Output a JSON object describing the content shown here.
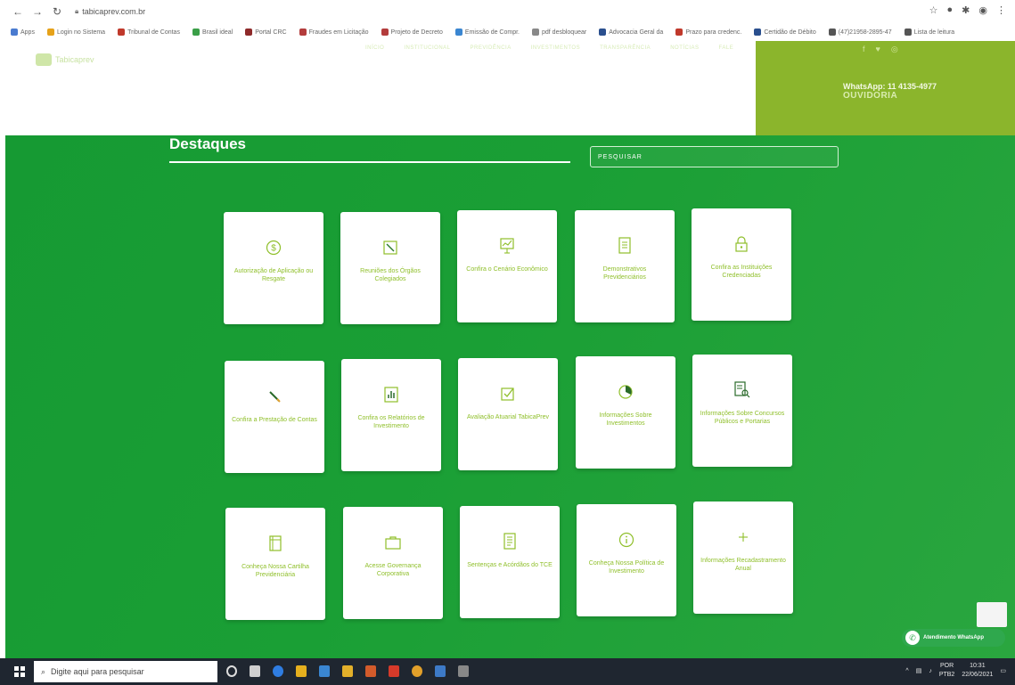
{
  "browser": {
    "url": "tabicaprev.com.br",
    "bookmarks": [
      {
        "label": "Apps",
        "color": "#4a7bd0"
      },
      {
        "label": "Login no Sistema",
        "color": "#e6a21a"
      },
      {
        "label": "Tribunal de Contas",
        "color": "#c0392b"
      },
      {
        "label": "Brasil ideal",
        "color": "#3a9f48"
      },
      {
        "label": "Portal CRC",
        "color": "#8e2a2a"
      },
      {
        "label": "Fraudes em Licitação",
        "color": "#b33c3c"
      },
      {
        "label": "Projeto de Decreto",
        "color": "#b33c3c"
      },
      {
        "label": "Emissão de Compr.",
        "color": "#3a86d1"
      },
      {
        "label": "pdf desbloquear",
        "color": "#888888"
      },
      {
        "label": "Advocacia Geral da",
        "color": "#2a4f8e"
      },
      {
        "label": "Prazo para credenc.",
        "color": "#c0392b"
      },
      {
        "label": "Certidão de Débito",
        "color": "#2a4f8e"
      },
      {
        "label": "(47)21958-2895-47",
        "color": "#555555"
      },
      {
        "label": "Lista de leitura",
        "color": "#555555"
      }
    ]
  },
  "header": {
    "logo_text": "Tabicaprev",
    "menu": [
      "INÍCIO",
      "INSTITUCIONAL",
      "PREVIDÊNCIA",
      "INVESTIMENTOS",
      "TRANSPARÊNCIA",
      "NOTÍCIAS",
      "FALE"
    ],
    "whatsapp": "WhatsApp: 11 4135-4977",
    "ouvidoria": "OUVIDORIA"
  },
  "main": {
    "title": "Destaques",
    "search_placeholder": "PESQUISAR"
  },
  "cards": [
    {
      "label": "Autorização de Aplicação ou Resgate",
      "icon": "dollar-icon"
    },
    {
      "label": "Reuniões dos Órgãos Colegiados",
      "icon": "edit-icon"
    },
    {
      "label": "Confira o Cenário Econômico",
      "icon": "chart-icon"
    },
    {
      "label": "Demonstrativos Previdenciários",
      "icon": "document-icon"
    },
    {
      "label": "Confira as Instituições Credenciadas",
      "icon": "lock-icon"
    },
    {
      "label": "Confira a Prestação de Contas",
      "icon": "pencil-icon"
    },
    {
      "label": "Confira os Relatórios de Investimento",
      "icon": "bar-chart-icon"
    },
    {
      "label": "Avaliação Atuarial TabicaPrev",
      "icon": "checkbox-icon"
    },
    {
      "label": "Informações Sobre Investimentos",
      "icon": "pie-chart-icon"
    },
    {
      "label": "Informações Sobre Concursos Públicos e Portarias",
      "icon": "file-search-icon"
    },
    {
      "label": "Conheça Nossa Cartilha Previdenciária",
      "icon": "book-icon"
    },
    {
      "label": "Acesse Governança Corporativa",
      "icon": "briefcase-icon"
    },
    {
      "label": "Sentenças e Acórdãos do TCE",
      "icon": "list-document-icon"
    },
    {
      "label": "Conheça Nossa Política de Investimento",
      "icon": "info-icon"
    },
    {
      "label": "Informações Recadastramento Anual",
      "icon": "plus-icon"
    }
  ],
  "whatsapp_button": "Atendimento WhatsApp",
  "taskbar": {
    "search_placeholder": "Digite aqui para pesquisar",
    "lang1": "POR",
    "lang2": "PTB2",
    "time": "10:31",
    "date": "22/06/2021"
  },
  "colors": {
    "main_green": "#169a33",
    "accent_lime": "#8fbf2a",
    "ouvidoria_bg": "#8bb52c"
  }
}
